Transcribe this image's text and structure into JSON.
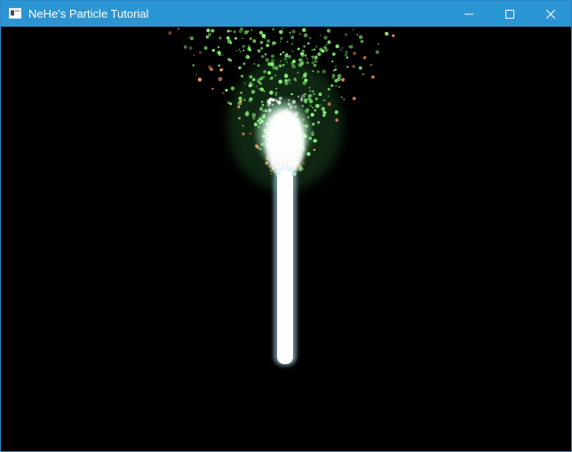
{
  "window": {
    "title": "NeHe's Particle Tutorial",
    "icons": {
      "app": "app-window-icon",
      "minimize": "minimize-icon",
      "maximize": "maximize-icon",
      "close": "close-icon"
    },
    "colors": {
      "titlebar": "#2b95d3",
      "client_background": "#000000",
      "particle_core": "#ffffff",
      "particle_green": "#8cff7a",
      "particle_orange": "#ff9b5a"
    }
  }
}
